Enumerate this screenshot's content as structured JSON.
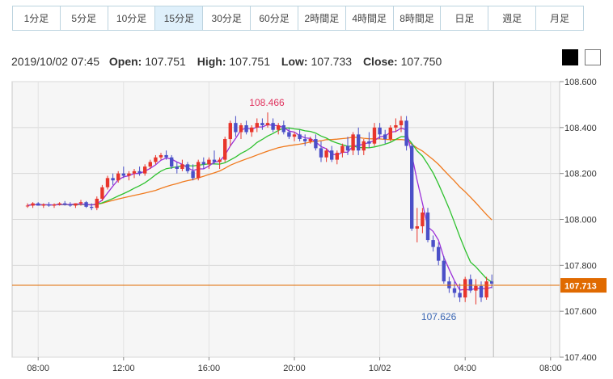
{
  "timeframes": [
    {
      "label": "1分足",
      "active": false
    },
    {
      "label": "5分足",
      "active": false
    },
    {
      "label": "10分足",
      "active": false
    },
    {
      "label": "15分足",
      "active": true
    },
    {
      "label": "30分足",
      "active": false
    },
    {
      "label": "60分足",
      "active": false
    },
    {
      "label": "2時間足",
      "active": false
    },
    {
      "label": "4時間足",
      "active": false
    },
    {
      "label": "8時間足",
      "active": false
    },
    {
      "label": "日足",
      "active": false
    },
    {
      "label": "週足",
      "active": false
    },
    {
      "label": "月足",
      "active": false
    }
  ],
  "ohlc": {
    "datetime": "2019/10/02 07:45",
    "open_label": "Open:",
    "open": "107.751",
    "high_label": "High:",
    "high": "107.751",
    "low_label": "Low:",
    "low": "107.733",
    "close_label": "Close:",
    "close": "107.750"
  },
  "theme_buttons": {
    "dark": "black-square",
    "light": "white-square"
  },
  "colors": {
    "up": "#e8352b",
    "down": "#4b50c8",
    "ma_short": "#9b30d9",
    "ma_mid": "#2ec12e",
    "ma_long": "#f07a1e",
    "current_price_line": "#e06a00",
    "high_label": "#e0335e",
    "low_label": "#3b67b4"
  },
  "chart_data": {
    "type": "candlestick",
    "ylim": [
      107.4,
      108.6
    ],
    "y_ticks": [
      "108.600",
      "108.400",
      "108.200",
      "108.000",
      "107.800",
      "107.600",
      "107.400"
    ],
    "x_ticks": [
      {
        "label": "08:00",
        "t": 2
      },
      {
        "label": "12:00",
        "t": 18
      },
      {
        "label": "16:00",
        "t": 34
      },
      {
        "label": "20:00",
        "t": 50
      },
      {
        "label": "10/02",
        "t": 66
      },
      {
        "label": "04:00",
        "t": 82
      },
      {
        "label": "08:00",
        "t": 98
      }
    ],
    "current_price": "107.713",
    "current_price_value": 107.713,
    "high_annotation": {
      "text": "108.466",
      "t": 45,
      "value": 108.466
    },
    "low_annotation": {
      "text": "107.626",
      "t": 76,
      "value": 107.626
    },
    "candles": [
      [
        108.06,
        108.07,
        108.05,
        108.06
      ],
      [
        108.06,
        108.075,
        108.05,
        108.07
      ],
      [
        108.07,
        108.075,
        108.06,
        108.06
      ],
      [
        108.06,
        108.07,
        108.05,
        108.065
      ],
      [
        108.065,
        108.075,
        108.055,
        108.06
      ],
      [
        108.06,
        108.07,
        108.05,
        108.065
      ],
      [
        108.065,
        108.075,
        108.06,
        108.07
      ],
      [
        108.07,
        108.08,
        108.06,
        108.065
      ],
      [
        108.065,
        108.075,
        108.055,
        108.06
      ],
      [
        108.06,
        108.07,
        108.05,
        108.07
      ],
      [
        108.07,
        108.085,
        108.06,
        108.075
      ],
      [
        108.075,
        108.08,
        108.05,
        108.055
      ],
      [
        108.055,
        108.07,
        108.04,
        108.05
      ],
      [
        108.05,
        108.1,
        108.04,
        108.09
      ],
      [
        108.09,
        108.15,
        108.08,
        108.14
      ],
      [
        108.14,
        108.19,
        108.13,
        108.18
      ],
      [
        108.18,
        108.2,
        108.15,
        108.17
      ],
      [
        108.17,
        108.21,
        108.16,
        108.2
      ],
      [
        108.2,
        108.23,
        108.18,
        108.19
      ],
      [
        108.19,
        108.21,
        108.17,
        108.2
      ],
      [
        108.2,
        108.22,
        108.18,
        108.21
      ],
      [
        108.21,
        108.23,
        108.19,
        108.2
      ],
      [
        108.2,
        108.24,
        108.19,
        108.23
      ],
      [
        108.23,
        108.26,
        108.22,
        108.25
      ],
      [
        108.25,
        108.28,
        108.24,
        108.27
      ],
      [
        108.27,
        108.29,
        108.26,
        108.28
      ],
      [
        108.28,
        108.3,
        108.26,
        108.27
      ],
      [
        108.27,
        108.28,
        108.22,
        108.23
      ],
      [
        108.23,
        108.25,
        108.2,
        108.22
      ],
      [
        108.22,
        108.26,
        108.21,
        108.24
      ],
      [
        108.24,
        108.25,
        108.2,
        108.21
      ],
      [
        108.21,
        108.24,
        108.17,
        108.18
      ],
      [
        108.18,
        108.26,
        108.17,
        108.25
      ],
      [
        108.25,
        108.27,
        108.22,
        108.24
      ],
      [
        108.24,
        108.27,
        108.22,
        108.26
      ],
      [
        108.26,
        108.3,
        108.24,
        108.25
      ],
      [
        108.25,
        108.27,
        108.22,
        108.26
      ],
      [
        108.26,
        108.36,
        108.25,
        108.35
      ],
      [
        108.35,
        108.43,
        108.32,
        108.42
      ],
      [
        108.42,
        108.45,
        108.36,
        108.38
      ],
      [
        108.38,
        108.42,
        108.35,
        108.41
      ],
      [
        108.41,
        108.43,
        108.37,
        108.38
      ],
      [
        108.38,
        108.41,
        108.36,
        108.4
      ],
      [
        108.4,
        108.44,
        108.38,
        108.42
      ],
      [
        108.42,
        108.44,
        108.39,
        108.41
      ],
      [
        108.41,
        108.466,
        108.4,
        108.42
      ],
      [
        108.42,
        108.44,
        108.38,
        108.39
      ],
      [
        108.39,
        108.42,
        108.37,
        108.41
      ],
      [
        108.41,
        108.43,
        108.37,
        108.38
      ],
      [
        108.38,
        108.4,
        108.35,
        108.36
      ],
      [
        108.36,
        108.38,
        108.34,
        108.37
      ],
      [
        108.37,
        108.39,
        108.34,
        108.35
      ],
      [
        108.35,
        108.37,
        108.32,
        108.34
      ],
      [
        108.34,
        108.36,
        108.33,
        108.35
      ],
      [
        108.35,
        108.37,
        108.3,
        108.31
      ],
      [
        108.31,
        108.34,
        108.25,
        108.27
      ],
      [
        108.27,
        108.31,
        108.25,
        108.3
      ],
      [
        108.3,
        108.32,
        108.25,
        108.26
      ],
      [
        108.26,
        108.3,
        108.24,
        108.29
      ],
      [
        108.29,
        108.33,
        108.27,
        108.32
      ],
      [
        108.32,
        108.36,
        108.28,
        108.3
      ],
      [
        108.3,
        108.38,
        108.28,
        108.37
      ],
      [
        108.37,
        108.4,
        108.28,
        108.3
      ],
      [
        108.3,
        108.35,
        108.28,
        108.34
      ],
      [
        108.34,
        108.38,
        108.31,
        108.33
      ],
      [
        108.33,
        108.42,
        108.32,
        108.4
      ],
      [
        108.4,
        108.42,
        108.35,
        108.37
      ],
      [
        108.37,
        108.39,
        108.33,
        108.35
      ],
      [
        108.35,
        108.41,
        108.34,
        108.4
      ],
      [
        108.4,
        108.44,
        108.38,
        108.41
      ],
      [
        108.41,
        108.45,
        108.38,
        108.43
      ],
      [
        108.43,
        108.45,
        108.3,
        108.32
      ],
      [
        108.32,
        108.33,
        107.95,
        107.96
      ],
      [
        107.96,
        108.05,
        107.9,
        107.97
      ],
      [
        107.97,
        108.05,
        107.94,
        108.03
      ],
      [
        108.03,
        108.05,
        107.9,
        107.91
      ],
      [
        107.91,
        107.93,
        107.86,
        107.88
      ],
      [
        107.88,
        107.9,
        107.8,
        107.82
      ],
      [
        107.82,
        107.84,
        107.72,
        107.73
      ],
      [
        107.73,
        107.75,
        107.68,
        107.7
      ],
      [
        107.7,
        107.73,
        107.66,
        107.68
      ],
      [
        107.68,
        107.72,
        107.64,
        107.66
      ],
      [
        107.66,
        107.75,
        107.64,
        107.74
      ],
      [
        107.74,
        107.76,
        107.68,
        107.69
      ],
      [
        107.69,
        107.74,
        107.63,
        107.71
      ],
      [
        107.71,
        107.73,
        107.64,
        107.66
      ],
      [
        107.66,
        107.75,
        107.65,
        107.73
      ],
      [
        107.73,
        107.76,
        107.7,
        107.72
      ]
    ]
  }
}
